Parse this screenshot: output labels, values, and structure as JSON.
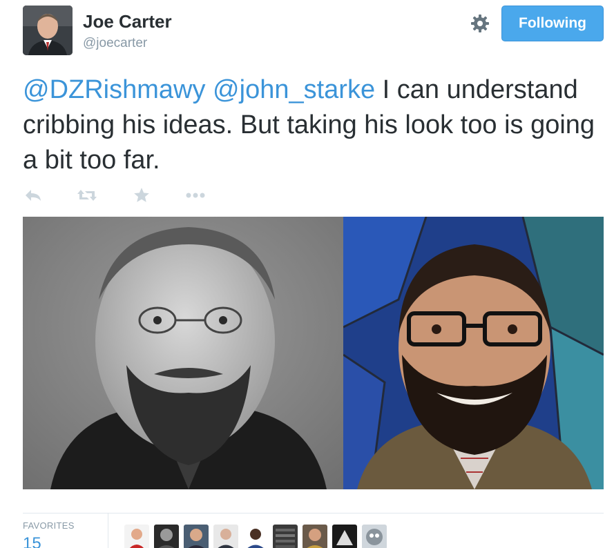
{
  "user": {
    "name": "Joe Carter",
    "handle": "@joecarter"
  },
  "follow_button": {
    "label": "Following"
  },
  "tweet": {
    "mentions": [
      "@DZRishmawy",
      "@john_starke"
    ],
    "text": " I can understand cribbing his ideas. But taking his look too is going a bit too far."
  },
  "actions": [
    {
      "icon": "reply-icon"
    },
    {
      "icon": "retweet-icon"
    },
    {
      "icon": "star-icon"
    },
    {
      "icon": "more-icon"
    }
  ],
  "stats": {
    "favorites_label": "FAVORITES",
    "favorites_count": "15"
  },
  "colors": {
    "link": "#3b94d9",
    "button": "#4aa8ec",
    "muted": "#8899a6",
    "action_icon": "#ccd6dd"
  }
}
